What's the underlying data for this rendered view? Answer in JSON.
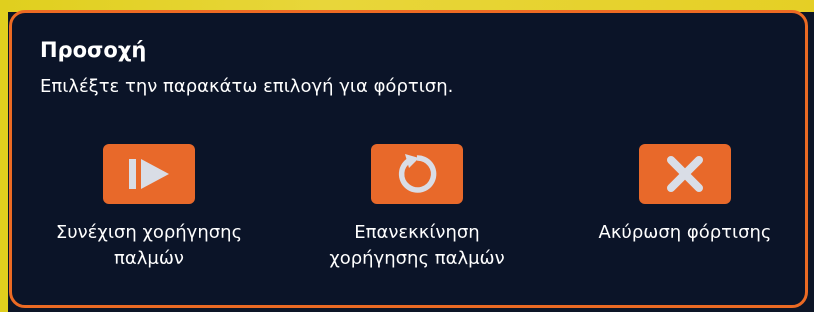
{
  "dialog": {
    "title": "Προσοχή",
    "message": "Επιλέξτε την παρακάτω επιλογή για φόρτιση."
  },
  "actions": [
    {
      "label": "Συνέχιση χορήγησης\nπαλμών",
      "icon": "resume-play-icon"
    },
    {
      "label": "Επανεκκίνηση\nχορήγησης παλμών",
      "icon": "restart-icon"
    },
    {
      "label": "Ακύρωση φόρτισης",
      "icon": "cancel-x-icon"
    }
  ],
  "colors": {
    "background": "#0b1428",
    "accent": "#e8692a",
    "border": "#ec6a23",
    "backdrop_yellow": "#e0cf1e",
    "text": "#ffffff",
    "icon_glyph": "#d9dde6"
  }
}
